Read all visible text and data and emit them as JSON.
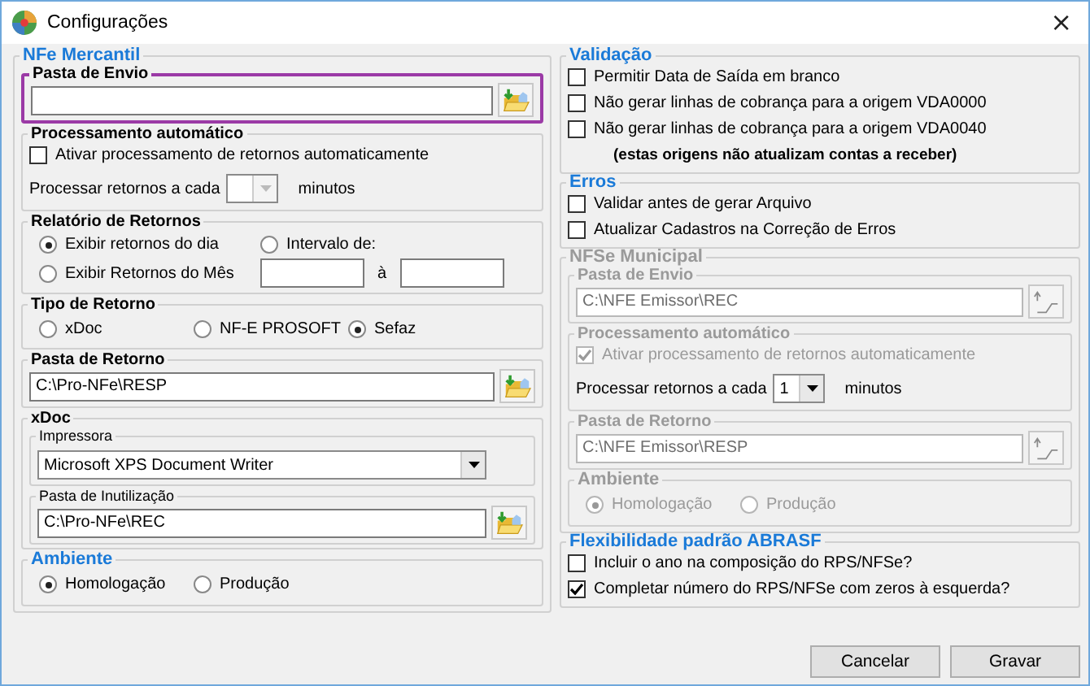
{
  "window": {
    "title": "Configurações",
    "close": "×"
  },
  "columns": [
    [
      {
        "kind": "section",
        "title": "NFe Mercantil",
        "items": [
          {
            "kind": "group",
            "title": "Pasta de Envio",
            "highlighted": true,
            "items": [
              {
                "kind": "folder"
              }
            ]
          },
          {
            "kind": "group",
            "title": "Processamento automático",
            "items": [
              {
                "kind": "checkbox",
                "label": "Ativar processamento de retornos automaticamente",
                "checked": false
              },
              {
                "kind": "interval",
                "label": "Processar retornos a cada",
                "unit": "minutos",
                "disabled": true
              }
            ]
          },
          {
            "kind": "group",
            "title": "Relatório de Retornos",
            "items": [
              {
                "kind": "report",
                "options": [
                  {
                    "label": "Exibir retornos do dia",
                    "selected": true
                  },
                  {
                    "label": "Intervalo de:",
                    "selected": false
                  },
                  {
                    "label": "Exibir Retornos do Mês",
                    "selected": false
                  }
                ],
                "separator": "à"
              }
            ]
          },
          {
            "kind": "group",
            "title": "Tipo de Retorno",
            "items": [
              {
                "kind": "radios",
                "options": [
                  {
                    "label": "xDoc",
                    "selected": false
                  },
                  {
                    "label": "NF-E PROSOFT",
                    "selected": false
                  },
                  {
                    "label": "Sefaz",
                    "selected": true
                  }
                ]
              }
            ]
          },
          {
            "kind": "group",
            "title": "Pasta de Retorno",
            "items": [
              {
                "kind": "folder",
                "value": "C:\\Pro-NFe\\RESP"
              }
            ]
          },
          {
            "kind": "group",
            "title": "xDoc",
            "items": [
              {
                "kind": "subgroup",
                "title": "Impressora",
                "items": [
                  {
                    "kind": "select",
                    "value": "Microsoft XPS Document Writer"
                  }
                ]
              },
              {
                "kind": "subgroup",
                "title": "Pasta de Inutilização",
                "items": [
                  {
                    "kind": "folder",
                    "value": "C:\\Pro-NFe\\REC"
                  }
                ]
              }
            ]
          },
          {
            "kind": "section",
            "title": "Ambiente",
            "items": [
              {
                "kind": "radios",
                "options": [
                  {
                    "label": "Homologação",
                    "selected": true
                  },
                  {
                    "label": "Produção",
                    "selected": false
                  }
                ]
              }
            ]
          }
        ]
      }
    ],
    [
      {
        "kind": "section",
        "title": "Validação",
        "items": [
          {
            "kind": "checkbox",
            "label": "Permitir Data de Saída em branco",
            "checked": false
          },
          {
            "kind": "checkbox",
            "label": "Não gerar linhas de cobrança para a origem VDA0000",
            "checked": false
          },
          {
            "kind": "checkbox",
            "label": "Não gerar linhas de cobrança para a origem VDA0040",
            "checked": false
          },
          {
            "kind": "note",
            "text": "(estas origens não atualizam contas a receber)"
          }
        ]
      },
      {
        "kind": "section",
        "title": "Erros",
        "items": [
          {
            "kind": "checkbox",
            "label": "Validar antes de gerar Arquivo",
            "checked": false
          },
          {
            "kind": "checkbox",
            "label": "Atualizar Cadastros na Correção de Erros",
            "checked": false
          }
        ]
      },
      {
        "kind": "section",
        "title": "NFSe Municipal",
        "disabled": true,
        "items": [
          {
            "kind": "group",
            "title": "Pasta de Envio",
            "items": [
              {
                "kind": "folder",
                "value": "C:\\NFE Emissor\\REC"
              }
            ]
          },
          {
            "kind": "group",
            "title": "Processamento automático",
            "items": [
              {
                "kind": "checkbox",
                "label": "Ativar processamento de retornos automaticamente",
                "checked": true
              },
              {
                "kind": "interval",
                "label": "Processar retornos a cada",
                "value": "1",
                "unit": "minutos",
                "disabled": false
              }
            ]
          },
          {
            "kind": "group",
            "title": "Pasta de Retorno",
            "items": [
              {
                "kind": "folder",
                "value": "C:\\NFE Emissor\\RESP"
              }
            ]
          },
          {
            "kind": "section",
            "title": "Ambiente",
            "items": [
              {
                "kind": "radios",
                "options": [
                  {
                    "label": "Homologação",
                    "selected": true
                  },
                  {
                    "label": "Produção",
                    "selected": false
                  }
                ]
              }
            ]
          }
        ]
      },
      {
        "kind": "section",
        "title": "Flexibilidade padrão ABRASF",
        "items": [
          {
            "kind": "checkbox",
            "label": "Incluir o ano na composição do RPS/NFSe?",
            "checked": false
          },
          {
            "kind": "checkbox",
            "label": "Completar número do RPS/NFSe com zeros à esquerda?",
            "checked": true
          }
        ]
      }
    ]
  ],
  "buttons": [
    "Cancelar",
    "Gravar"
  ]
}
